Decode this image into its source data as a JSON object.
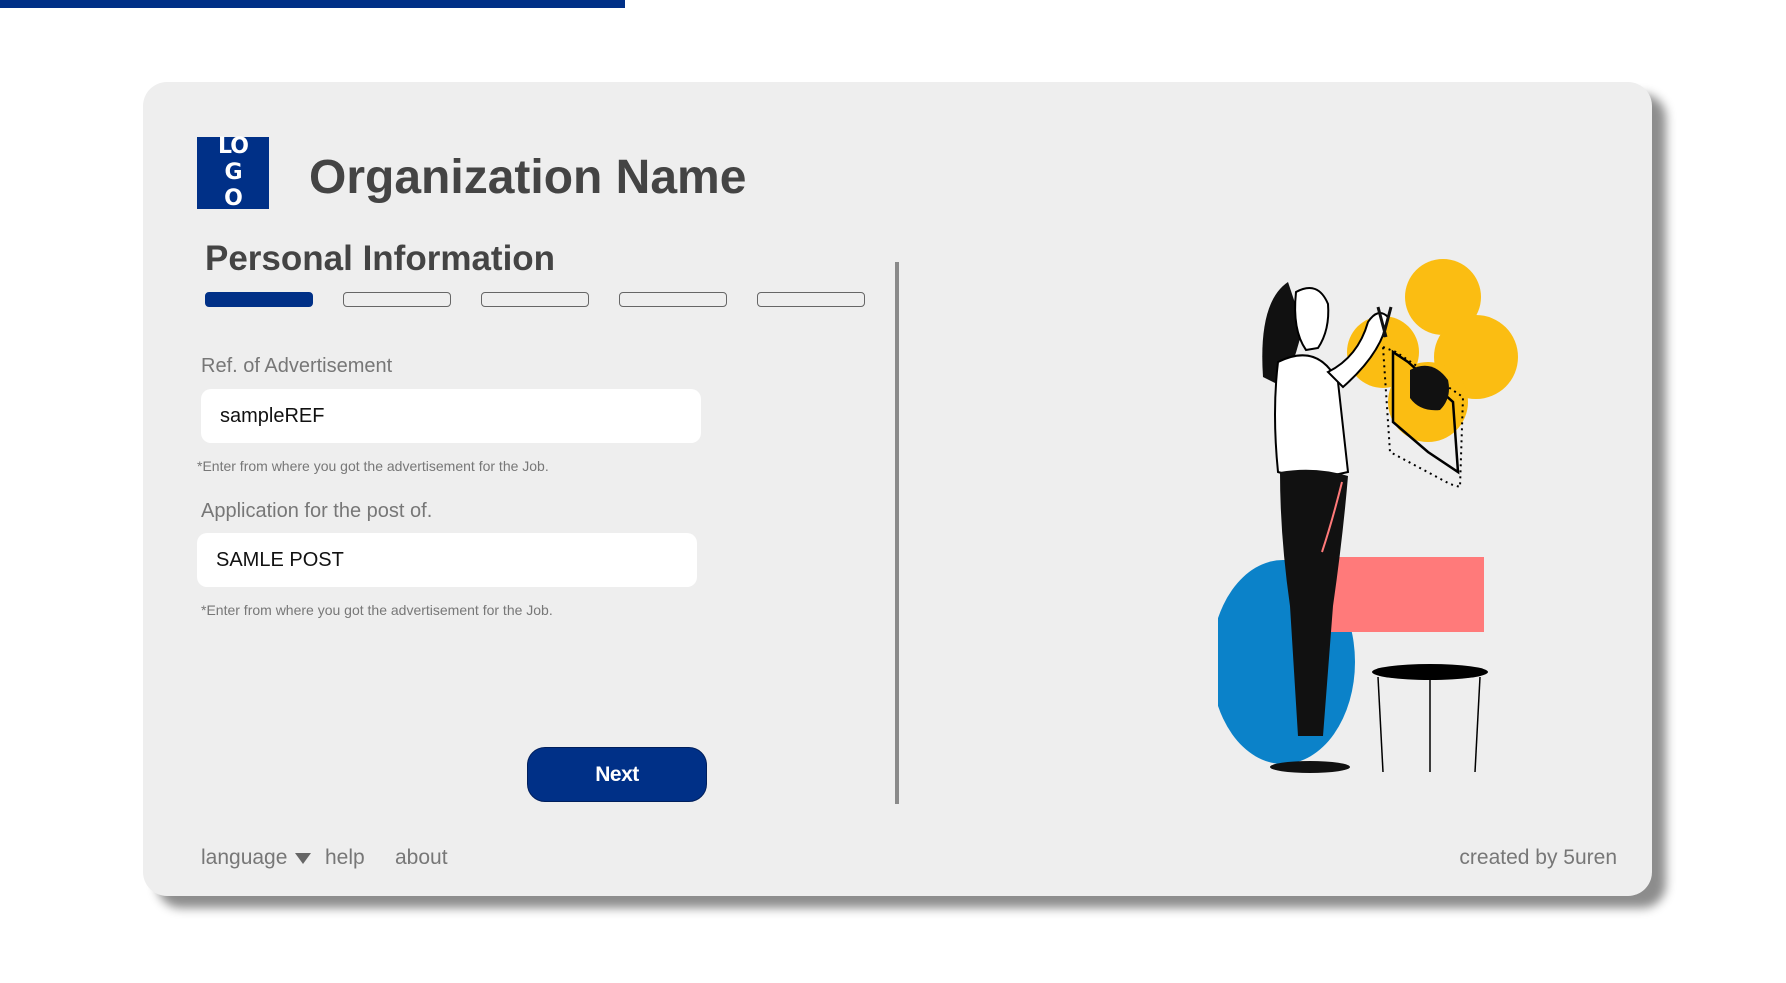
{
  "page_progress": {
    "fraction": 0.35
  },
  "header": {
    "logo_text": "LO GO",
    "org_name": "Organization Name"
  },
  "form": {
    "section_title": "Personal Information",
    "steps": {
      "total": 5,
      "current": 1
    },
    "fields": [
      {
        "label": "Ref. of Advertisement",
        "value": "sampleREF",
        "hint": "*Enter from where you got the advertisement for the Job."
      },
      {
        "label": "Application for the post of.",
        "value": "SAMLE POST",
        "hint": "*Enter from where you got the advertisement for the Job."
      }
    ],
    "next_label": "Next"
  },
  "footer": {
    "language_label": "language",
    "help_label": "help",
    "about_label": "about",
    "credit": "created by 5uren"
  },
  "colors": {
    "brand": "#003087",
    "card_bg": "#eeeeee",
    "illustration_blue": "#0b82c9",
    "illustration_pink": "#ff7a7a",
    "illustration_yellow": "#fbbd12"
  },
  "illustration": {
    "name": "woman-cutting-hair-in-mirror-illustration"
  }
}
